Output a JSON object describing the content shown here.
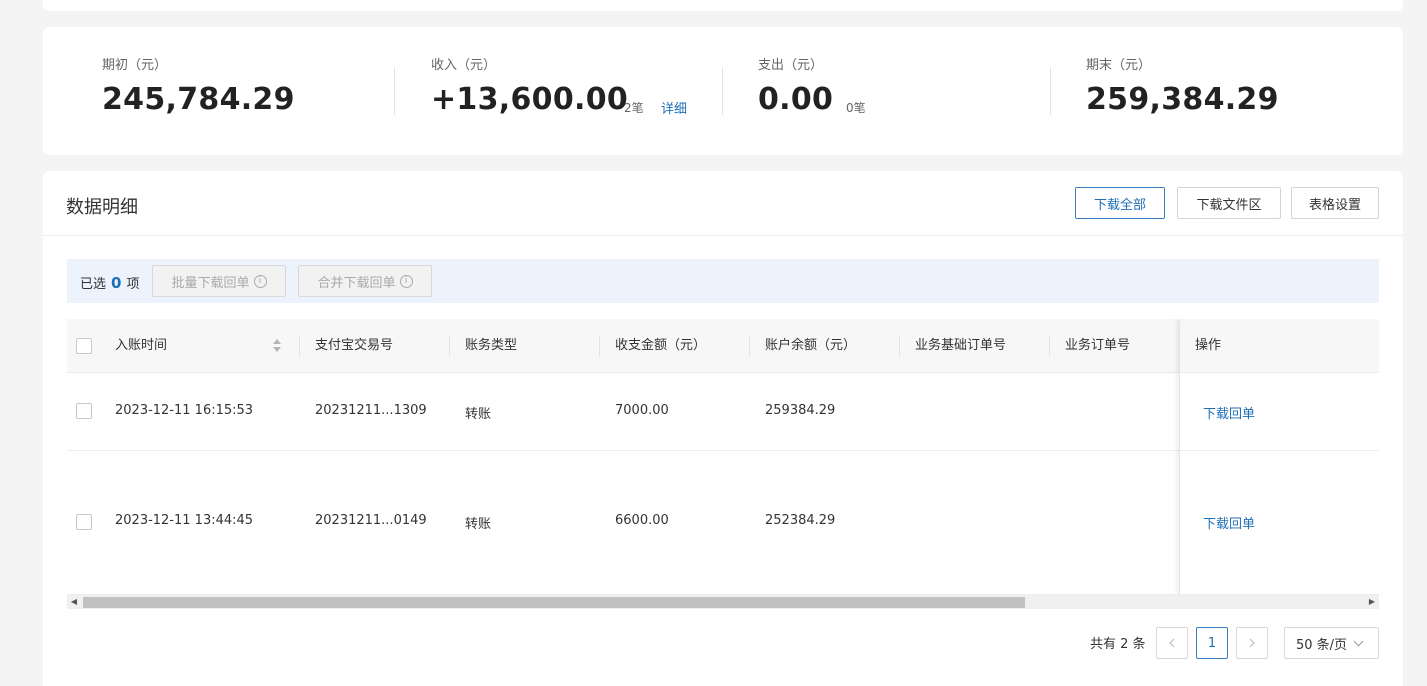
{
  "summary": {
    "opening_label": "期初（元）",
    "opening_value": "245,784.29",
    "income_label": "收入（元）",
    "income_value": "+13,600.00",
    "income_count": "2笔",
    "income_detail_link": "详细",
    "expense_label": "支出（元）",
    "expense_value": "0.00",
    "expense_count": "0笔",
    "closing_label": "期末（元）",
    "closing_value": "259,384.29"
  },
  "detail": {
    "title": "数据明细",
    "toolbar": {
      "download_all": "下载全部",
      "download_files": "下载文件区",
      "table_settings": "表格设置"
    },
    "selection": {
      "prefix": "已选",
      "count": "0",
      "suffix": "项",
      "batch_download": "批量下载回单",
      "merge_download": "合并下载回单",
      "info_icon": "info-circle-icon"
    },
    "columns": [
      "入账时间",
      "支付宝交易号",
      "账务类型",
      "收支金额（元）",
      "账户余额（元）",
      "业务基础订单号",
      "业务订单号",
      "操作"
    ],
    "rows": [
      {
        "time": "2023-12-11 16:15:53",
        "trade_no": "20231211...1309",
        "type": "转账",
        "amount": "7000.00",
        "balance": "259384.29",
        "base_order": "",
        "order": "",
        "action": "下载回单"
      },
      {
        "time": "2023-12-11 13:44:45",
        "trade_no": "20231211...0149",
        "type": "转账",
        "amount": "6600.00",
        "balance": "252384.29",
        "base_order": "",
        "order": "",
        "action": "下载回单"
      }
    ],
    "pagination": {
      "total": "共有 2 条",
      "prev_icon": "chevron-left-icon",
      "current_page": "1",
      "next_icon": "chevron-right-icon",
      "page_size": "50 条/页"
    }
  },
  "colors": {
    "accent": "#1f6fb6",
    "background": "#f4f4f5",
    "selection_bar": "#ecf3fc"
  }
}
